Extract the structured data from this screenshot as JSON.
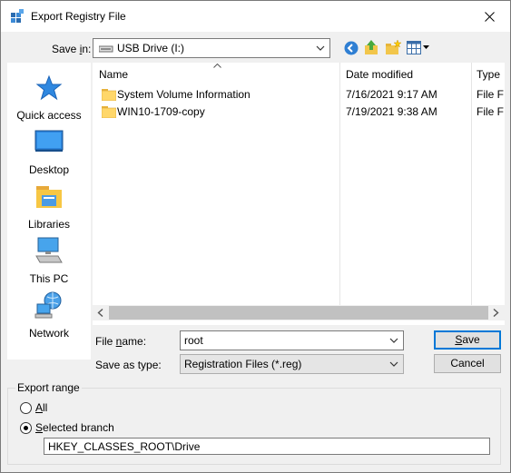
{
  "window": {
    "title": "Export Registry File",
    "close_label": "✕"
  },
  "save_in": {
    "label_pre": "Save ",
    "label_key": "i",
    "label_post": "n:",
    "value": "USB Drive (I:)"
  },
  "places": [
    {
      "label": "Quick access",
      "icon": "star-icon"
    },
    {
      "label": "Desktop",
      "icon": "desktop-icon"
    },
    {
      "label": "Libraries",
      "icon": "libraries-icon"
    },
    {
      "label": "This PC",
      "icon": "pc-icon"
    },
    {
      "label": "Network",
      "icon": "network-icon"
    }
  ],
  "columns": {
    "name": "Name",
    "date": "Date modified",
    "type": "Type"
  },
  "files": [
    {
      "name": "System Volume Information",
      "date": "7/16/2021 9:17 AM",
      "type": "File F"
    },
    {
      "name": "WIN10-1709-copy",
      "date": "7/19/2021 9:38 AM",
      "type": "File F"
    }
  ],
  "filename": {
    "label_pre": "File ",
    "label_key": "n",
    "label_post": "ame:",
    "value": "root"
  },
  "savetype": {
    "label": "Save as type:",
    "value": "Registration Files (*.reg)"
  },
  "buttons": {
    "save_key": "S",
    "save_rest": "ave",
    "cancel": "Cancel"
  },
  "export_range": {
    "label": "Export range",
    "all_key": "A",
    "all_rest": "ll",
    "selected_key": "S",
    "selected_rest": "elected branch",
    "branch_value": "HKEY_CLASSES_ROOT\\Drive"
  },
  "colors": {
    "accent": "#0078d7",
    "folder": "#ffd76a"
  }
}
